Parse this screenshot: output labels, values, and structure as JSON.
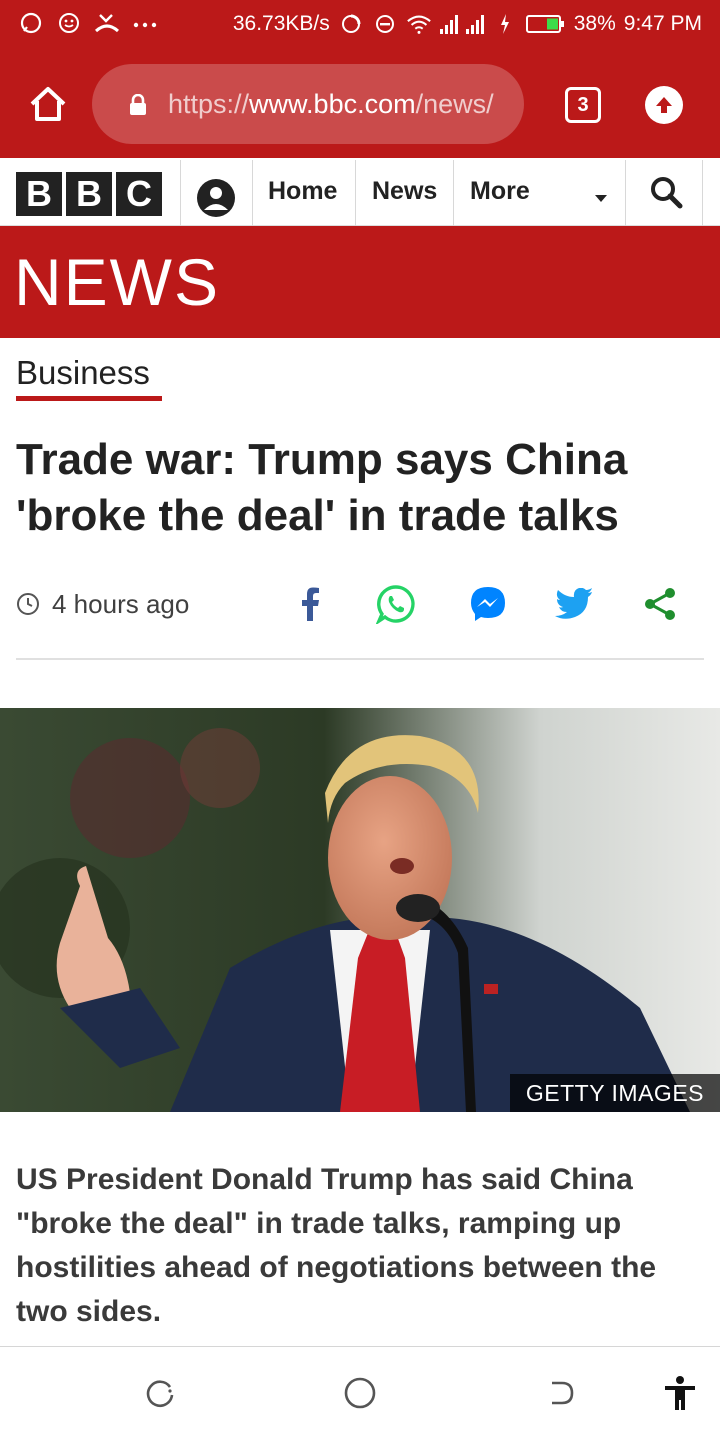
{
  "status_bar": {
    "speed": "36.73KB/s",
    "battery": "38%",
    "time": "9:47 PM",
    "icons": [
      "chat-bubble-icon",
      "smiley-icon",
      "missed-call-icon",
      "more-dots-icon",
      "data-saver-icon",
      "dnd-icon",
      "wifi-icon",
      "signal-icon",
      "signal-icon",
      "charging-icon",
      "battery-icon"
    ]
  },
  "browser": {
    "url_scheme": "https://",
    "url_host": "www.bbc.com",
    "url_path": "/news/",
    "tab_count": "3",
    "colors": {
      "toolbar": "#bb1919"
    }
  },
  "bbc_nav": {
    "logo_letters": [
      "B",
      "B",
      "C"
    ],
    "links": [
      "Home",
      "News",
      "More"
    ]
  },
  "banner": {
    "title": "NEWS"
  },
  "article": {
    "section": "Business",
    "headline": "Trade war: Trump says China 'broke the deal' in trade talks",
    "timestamp": "4 hours ago",
    "share_icons": [
      "facebook-icon",
      "whatsapp-icon",
      "messenger-icon",
      "twitter-icon",
      "share-icon"
    ],
    "image_credit": "GETTY IMAGES",
    "summary": "US President Donald Trump has said China \"broke the deal\" in trade talks, ramping up hostilities ahead of negotiations between the two sides."
  },
  "system_nav": {
    "icons": [
      "recent-apps-icon",
      "home-circle-icon",
      "back-icon",
      "accessibility-icon"
    ]
  }
}
